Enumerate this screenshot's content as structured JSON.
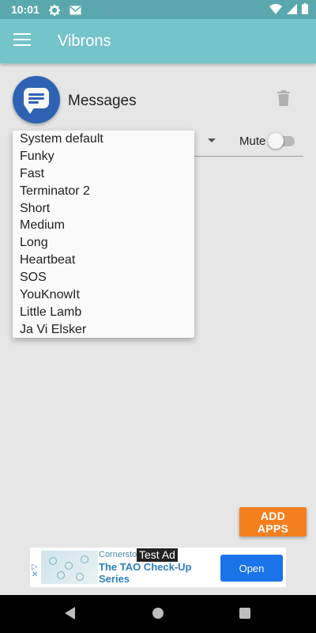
{
  "status_bar": {
    "time": "10:01",
    "icons": [
      "gear-icon",
      "gmail-icon",
      "wifi-icon",
      "signal-icon",
      "battery-icon"
    ]
  },
  "app_bar": {
    "title": "Vibrons",
    "menu_icon": "hamburger-menu-icon"
  },
  "app_entry": {
    "name": "Messages",
    "icon": "messages-app-icon",
    "delete_icon": "trash-icon",
    "mute_label": "Mute",
    "mute_on": false
  },
  "dropdown": {
    "options": [
      "System default",
      "Funky",
      "Fast",
      "Terminator 2",
      "Short",
      "Medium",
      "Long",
      "Heartbeat",
      "SOS",
      "YouKnowIt",
      "Little Lamb",
      "Ja Vi Elsker"
    ]
  },
  "add_apps_label": "ADD APPS",
  "ad": {
    "brand": "Cornerstone",
    "headline": "The TAO Check-Up Series",
    "test_label": "Test Ad",
    "open_label": "Open"
  },
  "nav": {
    "icons": [
      "back-icon",
      "home-icon",
      "recents-icon"
    ]
  },
  "colors": {
    "status_bar": "#5aa8ae",
    "app_bar": "#75c4c9",
    "accent_button": "#f47f1f",
    "background": "#e6e6e6",
    "app_icon": "#2f62b3"
  }
}
